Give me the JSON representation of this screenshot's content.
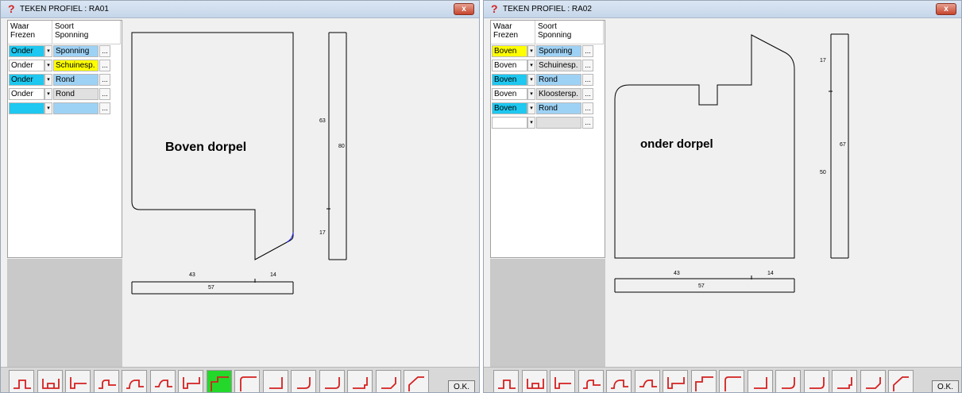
{
  "windows": [
    {
      "title": "TEKEN PROFIEL : RA01",
      "close_label": "x",
      "headers": {
        "col1": "Waar\nFrezen",
        "col2": "Soort\nSponning"
      },
      "rows": [
        {
          "waar": "Onder",
          "soort": "Sponning",
          "waar_bg": "#1ec8f0",
          "soort_bg": "#9ed2f5"
        },
        {
          "waar": "Onder",
          "soort": "Schuinesp.",
          "waar_bg": "#ffffff",
          "soort_bg": "#ffff00"
        },
        {
          "waar": "Onder",
          "soort": "Rond",
          "waar_bg": "#1ec8f0",
          "soort_bg": "#9ed2f5"
        },
        {
          "waar": "Onder",
          "soort": "Rond",
          "waar_bg": "#ffffff",
          "soort_bg": "#e0e0e0"
        },
        {
          "waar": "",
          "soort": "",
          "waar_bg": "#1ec8f0",
          "soort_bg": "#9ed2f5"
        }
      ],
      "profile_label": "Boven dorpel",
      "dims": {
        "top_a": "43",
        "top_b": "14",
        "total": "57",
        "right_a": "63",
        "right_b": "17",
        "right_total": "80"
      },
      "active_tool": 7,
      "ok_label": "O.K."
    },
    {
      "title": "TEKEN PROFIEL : RA02",
      "close_label": "x",
      "headers": {
        "col1": "Waar\nFrezen",
        "col2": "Soort\nSponning"
      },
      "rows": [
        {
          "waar": "Boven",
          "soort": "Sponning",
          "waar_bg": "#ffff00",
          "soort_bg": "#9ed2f5"
        },
        {
          "waar": "Boven",
          "soort": "Schuinesp.",
          "waar_bg": "#ffffff",
          "soort_bg": "#e0e0e0"
        },
        {
          "waar": "Boven",
          "soort": "Rond",
          "waar_bg": "#1ec8f0",
          "soort_bg": "#9ed2f5"
        },
        {
          "waar": "Boven",
          "soort": "Kloostersp.",
          "waar_bg": "#ffffff",
          "soort_bg": "#e0e0e0"
        },
        {
          "waar": "Boven",
          "soort": "Rond",
          "waar_bg": "#1ec8f0",
          "soort_bg": "#9ed2f5"
        },
        {
          "waar": "",
          "soort": "",
          "waar_bg": "#ffffff",
          "soort_bg": "#e0e0e0"
        }
      ],
      "profile_label": "onder dorpel",
      "dims": {
        "top_a": "43",
        "top_b": "14",
        "total": "57",
        "right_a": "17",
        "right_b": "50",
        "right_total": "67"
      },
      "active_tool": -1,
      "ok_label": "O.K."
    }
  ],
  "tool_icons": [
    "rebate-step-icon",
    "double-rebate-icon",
    "corner-rebate-icon",
    "bevel-step-icon",
    "bevel-step-2-icon",
    "bevel-step-3-icon",
    "corner-rebate-2-icon",
    "stair-up-icon",
    "stair-up-2-icon",
    "corner-down-icon",
    "round-corner-icon",
    "round-corner-2-icon",
    "bead-corner-icon",
    "bevel-corner-icon",
    "slope-corner-icon"
  ],
  "colors": {
    "tool_red": "#d42020",
    "active_tool_bg": "#23d82b",
    "profile_line": "#000000",
    "profile_arc": "#2020ff"
  }
}
